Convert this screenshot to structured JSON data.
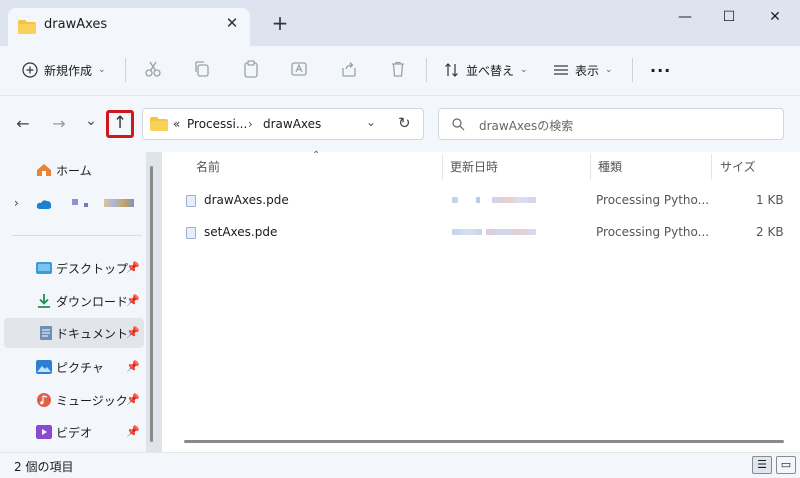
{
  "window": {
    "tab_title": "drawAxes",
    "close_tab_glyph": "✕",
    "new_tab_glyph": "+",
    "minimize_glyph": "—",
    "maximize_glyph": "☐",
    "close_glyph": "✕"
  },
  "toolbar": {
    "new_label": "新規作成",
    "sort_label": "並べ替え",
    "view_label": "表示",
    "more_glyph": "···"
  },
  "nav": {
    "back_glyph": "←",
    "forward_glyph": "→",
    "recent_glyph": "⌄",
    "up_glyph": "↑",
    "refresh_glyph": "↻"
  },
  "address": {
    "prefix": "«",
    "segments": [
      "Processi...",
      "drawAxes"
    ],
    "separator": "›"
  },
  "search": {
    "placeholder": "drawAxesの検索"
  },
  "sidebar": {
    "items": [
      {
        "label": "ホーム",
        "icon": "home-icon"
      },
      {
        "label": "",
        "icon": "onedrive-icon"
      },
      {
        "label": "デスクトップ",
        "icon": "desktop-icon",
        "pinned": true
      },
      {
        "label": "ダウンロード",
        "icon": "download-icon",
        "pinned": true
      },
      {
        "label": "ドキュメント",
        "icon": "documents-icon",
        "pinned": true
      },
      {
        "label": "ピクチャ",
        "icon": "pictures-icon",
        "pinned": true
      },
      {
        "label": "ミュージック",
        "icon": "music-icon",
        "pinned": true
      },
      {
        "label": "ビデオ",
        "icon": "videos-icon",
        "pinned": true
      }
    ]
  },
  "columns": {
    "name": "名前",
    "modified": "更新日時",
    "type": "種類",
    "size": "サイズ"
  },
  "files": [
    {
      "name": "drawAxes.pde",
      "type": "Processing Pytho...",
      "size": "1 KB"
    },
    {
      "name": "setAxes.pde",
      "type": "Processing Pytho...",
      "size": "2 KB"
    }
  ],
  "status": {
    "item_count": "2 個の項目"
  },
  "colors": {
    "accent_highlight": "#d0171c",
    "folder": "#f4c542",
    "window_bg": "#f3f6fa"
  }
}
